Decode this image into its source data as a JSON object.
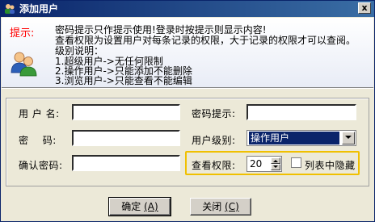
{
  "window": {
    "title": "添加用户",
    "close_label": "x"
  },
  "info": {
    "tip_label": "提示:",
    "lines": [
      "密码提示只作提示使用!登录时按提示则显示内容!",
      "查看权限为设置用户对每条记录的权限，大于记录的权限才可以查阅。",
      "级别说明：",
      "1.超级用户->无任何限制",
      "2.操作用户->只能添加不能删除",
      "3.浏览用户->只能查看不能编辑"
    ]
  },
  "form": {
    "username_label": "用 户 名:",
    "username_value": "",
    "password_label": "密    码:",
    "password_value": "",
    "confirm_label": "确认密码:",
    "confirm_value": "",
    "hint_label": "密码提示:",
    "hint_value": "",
    "level_label": "用户级别:",
    "level_value": "操作用户",
    "view_label": "查看权限:",
    "view_value": "20",
    "hide_label": "列表中隐藏"
  },
  "buttons": {
    "ok_label": "确定",
    "ok_hotkey": "(A)",
    "close_label": "关闭",
    "close_hotkey": "(C)"
  },
  "colors": {
    "title_bar": "#0a246a",
    "tip_red": "#ff0000",
    "highlight": "#f0c000"
  }
}
